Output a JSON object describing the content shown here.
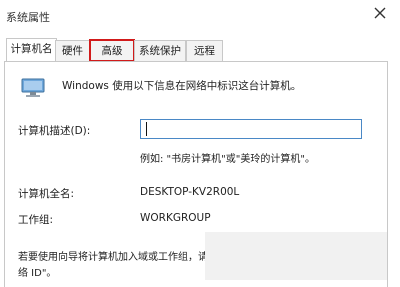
{
  "window": {
    "title": "系统属性"
  },
  "tabs": [
    {
      "label": "计算机名",
      "active": true
    },
    {
      "label": "硬件",
      "active": false
    },
    {
      "label": "高级",
      "active": false,
      "highlighted": true
    },
    {
      "label": "系统保护",
      "active": false
    },
    {
      "label": "远程",
      "active": false
    }
  ],
  "panel": {
    "info_text": "Windows 使用以下信息在网络中标识这台计算机。",
    "description_label": "计算机描述(D):",
    "description_value": "",
    "example_text": "例如: \"书房计算机\"或\"美玲的计算机\"。",
    "full_name_label": "计算机全名:",
    "full_name_value": "DESKTOP-KV2R00L",
    "workgroup_label": "工作组:",
    "workgroup_value": "WORKGROUP",
    "join_text_line1": "若要使用向导将计算机加入域或工作组，请单击",
    "join_text_line2": "络 ID\"。"
  },
  "colors": {
    "highlight": "#d11a1a",
    "input_border": "#4a88c6"
  },
  "icons": {
    "close": "close-icon",
    "computer": "computer-icon"
  }
}
